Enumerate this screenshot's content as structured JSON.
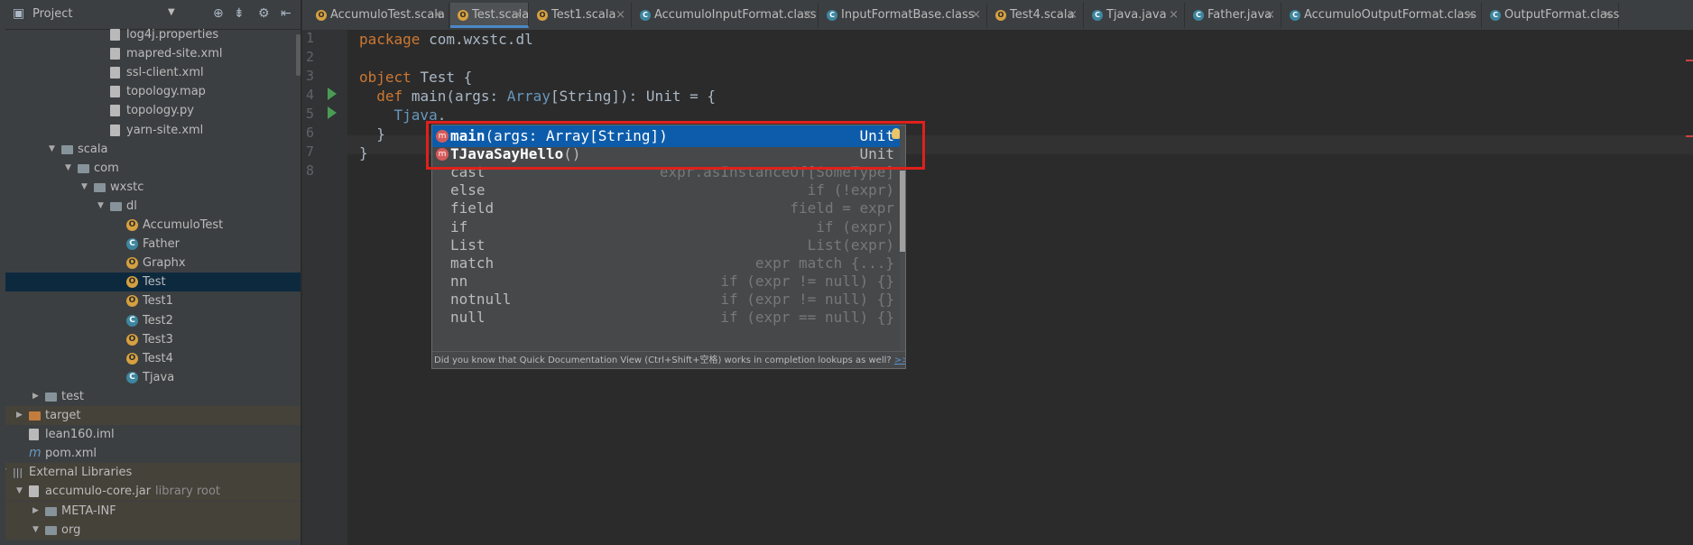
{
  "project_panel": {
    "title": "Project",
    "tree": [
      {
        "label": "log4j.properties",
        "icon": "properties-file-icon",
        "depth": 6
      },
      {
        "label": "mapred-site.xml",
        "icon": "xml-file-icon",
        "depth": 6
      },
      {
        "label": "ssl-client.xml",
        "icon": "xml-file-icon",
        "depth": 6
      },
      {
        "label": "topology.map",
        "icon": "file-icon",
        "depth": 6
      },
      {
        "label": "topology.py",
        "icon": "python-file-icon",
        "depth": 6
      },
      {
        "label": "yarn-site.xml",
        "icon": "xml-file-icon",
        "depth": 6
      },
      {
        "label": "scala",
        "icon": "folder-icon",
        "depth": 3,
        "expanded": true
      },
      {
        "label": "com",
        "icon": "package-icon",
        "depth": 4,
        "expanded": true
      },
      {
        "label": "wxstc",
        "icon": "package-icon",
        "depth": 5,
        "expanded": true
      },
      {
        "label": "dl",
        "icon": "package-icon",
        "depth": 6,
        "expanded": true
      },
      {
        "label": "AccumuloTest",
        "icon": "scala-object-icon",
        "depth": 7
      },
      {
        "label": "Father",
        "icon": "class-icon",
        "depth": 7
      },
      {
        "label": "Graphx",
        "icon": "scala-object-icon",
        "depth": 7
      },
      {
        "label": "Test",
        "icon": "scala-object-icon",
        "depth": 7,
        "selected": true
      },
      {
        "label": "Test1",
        "icon": "scala-object-icon",
        "depth": 7
      },
      {
        "label": "Test2",
        "icon": "class-icon",
        "depth": 7
      },
      {
        "label": "Test3",
        "icon": "scala-object-icon",
        "depth": 7
      },
      {
        "label": "Test4",
        "icon": "scala-object-icon",
        "depth": 7
      },
      {
        "label": "Tjava",
        "icon": "java-class-icon",
        "depth": 7
      },
      {
        "label": "test",
        "icon": "folder-icon",
        "depth": 2,
        "collapsed": true
      },
      {
        "label": "target",
        "icon": "folder-orange-icon",
        "depth": 1,
        "collapsed": true,
        "highlight": true
      },
      {
        "label": "lean160.iml",
        "icon": "iml-file-icon",
        "depth": 1
      },
      {
        "label": "pom.xml",
        "icon": "maven-file-icon",
        "depth": 1
      },
      {
        "label": "External Libraries",
        "icon": "libraries-icon",
        "depth": 0,
        "expanded": true,
        "highlight": true
      },
      {
        "label": "accumulo-core.jar",
        "extra": "library root",
        "icon": "jar-icon",
        "depth": 1,
        "expanded": true,
        "highlight": true
      },
      {
        "label": "META-INF",
        "icon": "folder-icon",
        "depth": 2,
        "collapsed": true,
        "highlight": true
      },
      {
        "label": "org",
        "icon": "package-icon",
        "depth": 2,
        "expanded": true,
        "highlight": true
      }
    ]
  },
  "tabs": [
    {
      "label": "AccumuloTest.scala",
      "icon": "o"
    },
    {
      "label": "Test.scala",
      "icon": "o",
      "active": true
    },
    {
      "label": "Test1.scala",
      "icon": "o"
    },
    {
      "label": "AccumuloInputFormat.class",
      "icon": "c"
    },
    {
      "label": "InputFormatBase.class",
      "icon": "c"
    },
    {
      "label": "Test4.scala",
      "icon": "o"
    },
    {
      "label": "Tjava.java",
      "icon": "c"
    },
    {
      "label": "Father.java",
      "icon": "c"
    },
    {
      "label": "AccumuloOutputFormat.class",
      "icon": "c"
    },
    {
      "label": "OutputFormat.class",
      "icon": "c"
    }
  ],
  "editor": {
    "line_numbers": [
      "1",
      "2",
      "3",
      "4",
      "5",
      "6",
      "7",
      "8"
    ],
    "lines": [
      "package com.wxstc.dl",
      "",
      "object Test {",
      "  def main(args: Array[String]): Unit = {",
      "    Tjava.",
      "  }",
      "}",
      ""
    ]
  },
  "completion": {
    "items": [
      {
        "name": "main",
        "params": "(args: Array[String])",
        "type": "Unit",
        "selected": true,
        "icon": "method-icon"
      },
      {
        "name": "TJavaSayHello",
        "params": "()",
        "type": "Unit",
        "icon": "method-icon"
      },
      {
        "name": "cast",
        "hint": "expr.asInstanceOf[SomeType]"
      },
      {
        "name": "else",
        "hint": "if (!expr)"
      },
      {
        "name": "field",
        "hint": "field = expr"
      },
      {
        "name": "if",
        "hint": "if (expr)"
      },
      {
        "name": "List",
        "hint": "List(expr)"
      },
      {
        "name": "match",
        "hint": "expr match {...}"
      },
      {
        "name": "nn",
        "hint": "if (expr != null) {}"
      },
      {
        "name": "notnull",
        "hint": "if (expr != null) {}"
      },
      {
        "name": "null",
        "hint": "if (expr == null) {}"
      }
    ],
    "footer_text": "Did you know that Quick Documentation View (Ctrl+Shift+空格) works in completion lookups as well?",
    "footer_link": ">> π"
  },
  "colors": {
    "keyword": "#cc7832",
    "type": "#6897bb",
    "selection": "#0d5cab",
    "highlight_box": "#e0201b"
  }
}
